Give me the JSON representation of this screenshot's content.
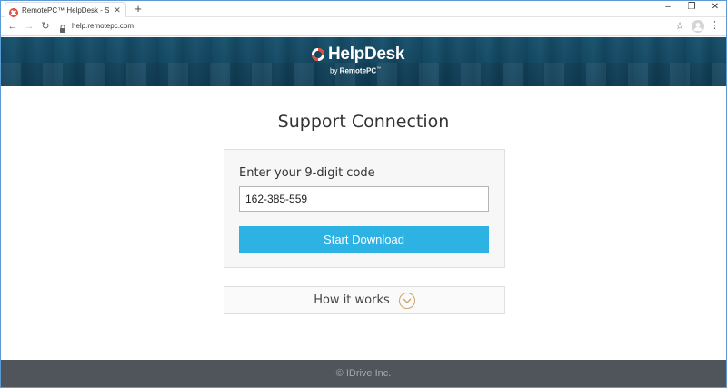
{
  "browser": {
    "tab_title": "RemotePC™ HelpDesk - Secure r",
    "url": "help.remotepc.com",
    "new_tab": "+",
    "controls": [
      "–",
      "❐",
      "✕"
    ]
  },
  "banner": {
    "logo_text": "HelpDesk",
    "logo_sub_prefix": "by ",
    "logo_sub_brand": "RemotePC",
    "logo_sub_tm": "™"
  },
  "main": {
    "heading": "Support Connection",
    "code_label": "Enter your 9-digit code",
    "code_value": "162-385-559",
    "start_button": "Start Download",
    "how_it_works": "How it works"
  },
  "footer": {
    "copyright": "© IDrive Inc."
  },
  "colors": {
    "accent": "#2db2e4",
    "footer_bg": "#50555b",
    "banner_bg": "#1b5470",
    "logo_red": "#e04a3b"
  },
  "icons": {
    "favicon": "lifebuoy-icon",
    "logo": "lifebuoy-icon",
    "how_toggle": "chevron-down-icon"
  }
}
